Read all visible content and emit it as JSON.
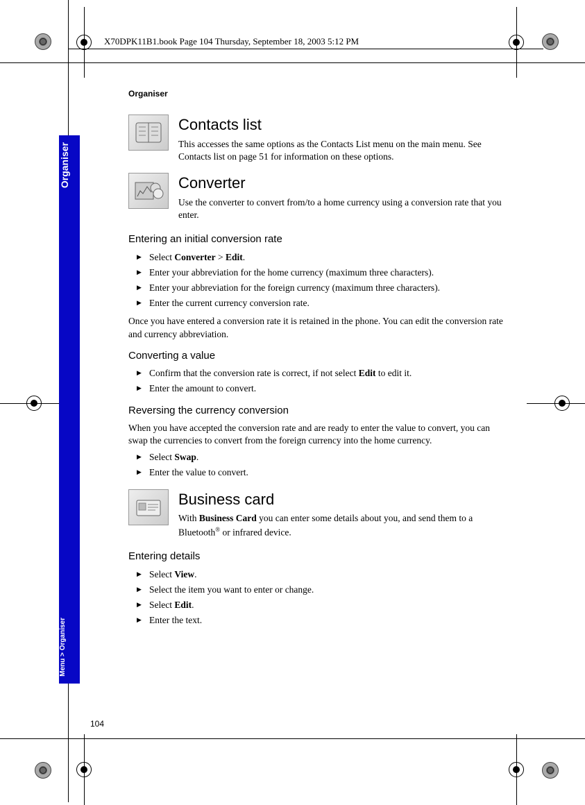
{
  "header": "X70DPK11B1.book  Page 104  Thursday, September 18, 2003  5:12 PM",
  "running_head": "Organiser",
  "tab": {
    "main": "Organiser",
    "path": "Menu > Organiser"
  },
  "page_number": "104",
  "sections": {
    "contacts": {
      "title": "Contacts list",
      "body": "This accesses the same options as the Contacts List menu on the main menu. See Contacts list on page 51 for information on these options."
    },
    "converter": {
      "title": "Converter",
      "body": "Use the converter to convert from/to a home currency using a conversion rate that you enter.",
      "sub1_title": "Entering an initial conversion rate",
      "sub1_steps": [
        "Select <b>Converter</b> > <b>Edit</b>.",
        "Enter your abbreviation for the home currency (maximum three characters).",
        "Enter your abbreviation for the foreign currency (maximum three characters).",
        "Enter the current currency conversion rate."
      ],
      "sub1_after": "Once you have entered a conversion rate it is retained in the phone. You can edit the conversion rate and currency abbreviation.",
      "sub2_title": "Converting a value",
      "sub2_steps": [
        "Confirm that the conversion rate is correct, if not select <b>Edit</b> to edit it.",
        "Enter the amount to convert."
      ],
      "sub3_title": "Reversing the currency conversion",
      "sub3_intro": "When you have accepted the conversion rate and are ready to enter the value to convert, you can swap the currencies to convert from the foreign currency into the home currency.",
      "sub3_steps": [
        "Select <b>Swap</b>.",
        "Enter the value to convert."
      ]
    },
    "business": {
      "title": "Business card",
      "body": "With <b>Business Card</b> you can enter some details about you, and send them to a Bluetooth<sup>®</sup> or infrared device.",
      "sub1_title": "Entering details",
      "sub1_steps": [
        "Select <b>View</b>.",
        "Select the item you want to enter or change.",
        "Select <b>Edit</b>.",
        "Enter the text."
      ]
    }
  }
}
